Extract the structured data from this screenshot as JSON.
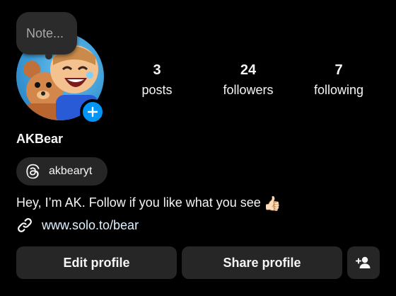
{
  "note": {
    "placeholder": "Note..."
  },
  "profile": {
    "username": "AKBear",
    "threads_handle": "akbearyt",
    "bio": "Hey, I’m AK. Follow if you like what you see",
    "bio_emoji": "👍🏻",
    "link": "www.solo.to/bear"
  },
  "stats": {
    "posts": {
      "count": "3",
      "label": "posts"
    },
    "followers": {
      "count": "24",
      "label": "followers"
    },
    "following": {
      "count": "7",
      "label": "following"
    }
  },
  "actions": {
    "edit_profile": "Edit profile",
    "share_profile": "Share profile"
  },
  "icons": {
    "add_story": "plus-icon",
    "threads": "threads-icon",
    "link": "link-icon",
    "discover_people": "add-person-icon"
  },
  "colors": {
    "background": "#000000",
    "button_bg": "#262626",
    "accent_blue": "#0095f6",
    "link_text": "#e0f1ff",
    "note_text": "#a8a8a8"
  }
}
